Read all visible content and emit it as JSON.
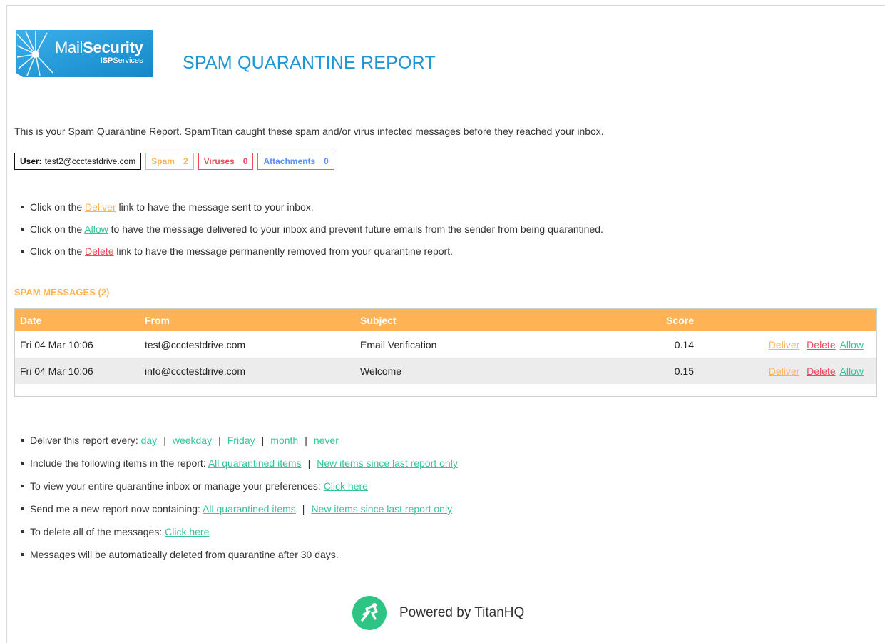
{
  "header": {
    "logo": {
      "main_light": "Mail",
      "main_bold": "Security",
      "sub_bold": "ISP",
      "sub_light": "Services"
    },
    "title": "SPAM QUARANTINE REPORT"
  },
  "intro": "This is your Spam Quarantine Report. SpamTitan caught these spam and/or virus infected messages before they reached your inbox.",
  "badges": {
    "user_label": "User:",
    "user_value": "test2@ccctestdrive.com",
    "spam_label": "Spam",
    "spam_count": "2",
    "viruses_label": "Viruses",
    "viruses_count": "0",
    "attachments_label": "Attachments",
    "attachments_count": "0"
  },
  "instructions": [
    {
      "pre": "Click on the ",
      "link": "Deliver",
      "post": " link to have the message sent to your inbox."
    },
    {
      "pre": "Click on the ",
      "link": "Allow",
      "post": " to have the message delivered to your inbox and prevent future emails from the sender from being quarantined."
    },
    {
      "pre": "Click on the ",
      "link": "Delete",
      "post": " link to have the message permanently removed from your quarantine report."
    }
  ],
  "spam_section": {
    "title": "SPAM MESSAGES (2)",
    "columns": {
      "date": "Date",
      "from": "From",
      "subject": "Subject",
      "score": "Score"
    },
    "rows": [
      {
        "date": "Fri 04 Mar 10:06",
        "from": "test@ccctestdrive.com",
        "subject": "Email Verification",
        "score": "0.14",
        "deliver": "Deliver",
        "delete": "Delete",
        "allow": "Allow"
      },
      {
        "date": "Fri 04 Mar 10:06",
        "from": "info@ccctestdrive.com",
        "subject": "Welcome",
        "score": "0.15",
        "deliver": "Deliver",
        "delete": "Delete",
        "allow": "Allow"
      }
    ]
  },
  "preferences": {
    "frequency": {
      "label": "Deliver this report every: ",
      "options": [
        "day",
        "weekday",
        "Friday",
        "month",
        "never"
      ]
    },
    "include": {
      "label": "Include the following items in the report: ",
      "options": [
        "All quarantined items",
        "New items since last report only"
      ]
    },
    "view": {
      "label": "To view your entire quarantine inbox or manage your preferences: ",
      "link": "Click here"
    },
    "send_now": {
      "label": "Send me a new report now containing: ",
      "options": [
        "All quarantined items",
        "New items since last report only"
      ]
    },
    "delete_all": {
      "label": "To delete all of the messages: ",
      "link": "Click here"
    },
    "auto_delete": "Messages will be automatically deleted from quarantine after 30 days."
  },
  "footer": {
    "text": "Powered by TitanHQ"
  },
  "colors": {
    "accent_blue": "#1e97d6",
    "spam_orange": "#ffb355",
    "virus_red": "#ef4a5c",
    "attach_blue": "#5b91f0",
    "link_green": "#37c49a",
    "titan_green": "#2ec584"
  }
}
